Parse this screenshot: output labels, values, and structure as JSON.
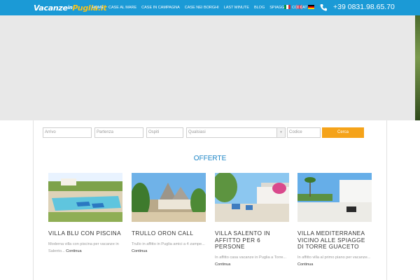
{
  "header": {
    "logo": {
      "part1": "Vacanze",
      "part2": "in",
      "part3": "Puglia",
      "part4": ".it"
    },
    "nav": [
      "HOME",
      "CASE AL MARE",
      "CASE IN CAMPAGNA",
      "CASE NEI BORGHI",
      "LAST MINUTE",
      "BLOG",
      "SPIAGGE",
      "CONTATTI"
    ],
    "phone": "+39 0831.98.65.70",
    "colors": {
      "bar": "#1b9ad6",
      "accent": "#f7c21a"
    }
  },
  "search": {
    "arrivo_placeholder": "Arrivo",
    "partenza_placeholder": "Partenza",
    "ospiti_placeholder": "Ospiti",
    "qualsiasi_value": "Qualsiasi",
    "codice_placeholder": "Codice",
    "button_label": "Cerca",
    "button_color": "#f5a31a"
  },
  "offers": {
    "title": "OFFERTE",
    "cards": [
      {
        "title": "VILLA BLU CON PISCINA",
        "desc": "Moderna villa con piscina per vacanze in Salento...",
        "more": "Continua"
      },
      {
        "title": "TRULLO ORON CALL",
        "desc": "Trullo in affitto in Puglia amici a 4 zampe...",
        "more": "Continua"
      },
      {
        "title": "VILLA SALENTO IN AFFITTO PER 6 PERSONE",
        "desc": "In affitto casa vacanze in Puglia a Torre...",
        "more": "Continua"
      },
      {
        "title": "VILLA MEDITERRANEA VICINO ALLE SPIAGGE DI TORRE GUACETO",
        "desc": "In affitto villa al primo piano per vacanze...",
        "more": "Continua"
      }
    ]
  }
}
